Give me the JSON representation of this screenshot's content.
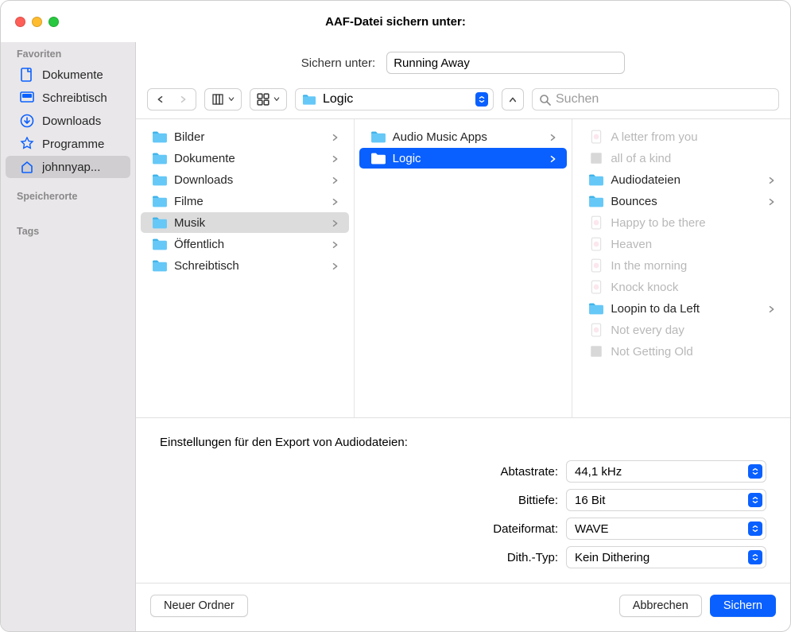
{
  "title": "AAF-Datei sichern unter:",
  "saveas_label": "Sichern unter:",
  "saveas_value": "Running Away",
  "location": "Logic",
  "search_placeholder": "Suchen",
  "sidebar": {
    "favorites_header": "Favoriten",
    "items": [
      {
        "label": "Dokumente",
        "icon": "doc"
      },
      {
        "label": "Schreibtisch",
        "icon": "desktop"
      },
      {
        "label": "Downloads",
        "icon": "download"
      },
      {
        "label": "Programme",
        "icon": "apps"
      },
      {
        "label": "johnnyap...",
        "icon": "home",
        "selected": true
      }
    ],
    "locations_header": "Speicherorte",
    "tags_header": "Tags"
  },
  "col1": [
    {
      "label": "Bilder"
    },
    {
      "label": "Dokumente"
    },
    {
      "label": "Downloads"
    },
    {
      "label": "Filme"
    },
    {
      "label": "Musik",
      "active": true
    },
    {
      "label": "Öffentlich"
    },
    {
      "label": "Schreibtisch"
    }
  ],
  "col2": [
    {
      "label": "Audio Music Apps"
    },
    {
      "label": "Logic",
      "selected": true
    }
  ],
  "col3": [
    {
      "label": "A letter from you",
      "dim": true,
      "icon": "file"
    },
    {
      "label": "all of a kind",
      "dim": true,
      "icon": "project"
    },
    {
      "label": "Audiodateien",
      "folder": true,
      "chev": true
    },
    {
      "label": "Bounces",
      "folder": true,
      "chev": true
    },
    {
      "label": "Happy to be there",
      "dim": true,
      "icon": "file"
    },
    {
      "label": "Heaven",
      "dim": true,
      "icon": "file"
    },
    {
      "label": "In the morning",
      "dim": true,
      "icon": "file"
    },
    {
      "label": "Knock knock",
      "dim": true,
      "icon": "file"
    },
    {
      "label": "Loopin to da Left",
      "folder": true,
      "chev": true
    },
    {
      "label": "Not every day",
      "dim": true,
      "icon": "file"
    },
    {
      "label": "Not Getting Old",
      "dim": true,
      "icon": "project"
    }
  ],
  "options": {
    "header": "Einstellungen für den Export von Audiodateien:",
    "rows": [
      {
        "label": "Abtastrate:",
        "value": "44,1 kHz"
      },
      {
        "label": "Bittiefe:",
        "value": "16 Bit"
      },
      {
        "label": "Dateiformat:",
        "value": "WAVE"
      },
      {
        "label": "Dith.-Typ:",
        "value": "Kein Dithering"
      }
    ]
  },
  "footer": {
    "new_folder": "Neuer Ordner",
    "cancel": "Abbrechen",
    "save": "Sichern"
  }
}
